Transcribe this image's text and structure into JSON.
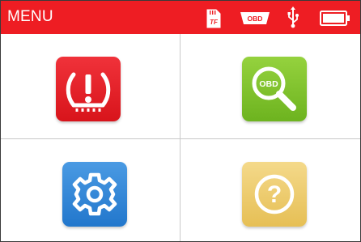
{
  "header": {
    "title": "MENU",
    "status_icons": [
      {
        "name": "sd-card-icon",
        "text": "TF"
      },
      {
        "name": "obd-connector-icon",
        "text": "OBD"
      },
      {
        "name": "usb-icon"
      },
      {
        "name": "battery-icon",
        "level": 1.0
      }
    ],
    "background_color": "#ee1d23"
  },
  "menu_items": [
    {
      "name": "tpms",
      "icon": "tire-pressure-warning-icon",
      "color": "#e21b22"
    },
    {
      "name": "obd",
      "icon": "obd-search-icon",
      "icon_text": "OBD",
      "color": "#7dc12a"
    },
    {
      "name": "settings",
      "icon": "gear-icon",
      "color": "#2f86d6"
    },
    {
      "name": "help",
      "icon": "help-icon",
      "icon_text": "?",
      "color": "#ecc866"
    }
  ]
}
